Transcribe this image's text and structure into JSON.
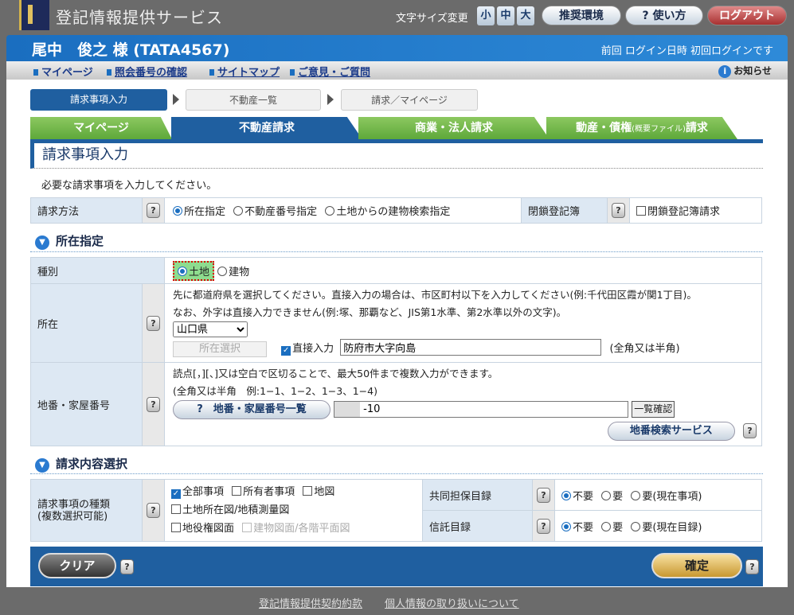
{
  "header": {
    "app_title": "登記情報提供サービス",
    "font_size_label": "文字サイズ変更",
    "font_sizes": [
      "小",
      "中",
      "大"
    ],
    "recommended_env": "推奨環境",
    "help": "使い方",
    "logout": "ログアウト"
  },
  "user": {
    "name": "尾中　俊之 様 (TATA4567)",
    "last_login": "前回 ログイン日時 初回ログインです"
  },
  "nav": {
    "links": [
      "マイページ",
      "照会番号の確認",
      "サイトマップ",
      "ご意見・ご質問"
    ],
    "notice": "お知らせ"
  },
  "steps": [
    "請求事項入力",
    "不動産一覧",
    "請求／マイページ"
  ],
  "tabs": [
    {
      "label": "マイページ"
    },
    {
      "label": "不動産請求"
    },
    {
      "label": "商業・法人請求"
    },
    {
      "label": "動産・債権",
      "sub": "(概要ファイル)",
      "suffix": "請求"
    }
  ],
  "page_title": "請求事項入力",
  "intro": "必要な請求事項を入力してください。",
  "method": {
    "label": "請求方法",
    "options": [
      "所在指定",
      "不動産番号指定",
      "土地からの建物検索指定"
    ],
    "selected": "所在指定",
    "closed_label": "閉鎖登記簿",
    "closed_option": "閉鎖登記簿請求"
  },
  "location_section": {
    "title": "所在指定",
    "kind": {
      "label": "種別",
      "options": [
        "土地",
        "建物"
      ],
      "selected": "土地"
    },
    "location": {
      "label": "所在",
      "note1": "先に都道府県を選択してください。直接入力の場合は、市区町村以下を入力してください(例:千代田区霞が関1丁目)。",
      "note2": "なお、外字は直接入力できません(例:塚、那覇など、JIS第1水準、第2水準以外の文字)。",
      "prefecture": "山口県",
      "select_button": "所在選択",
      "direct_input_label": "直接入力",
      "direct_input_value": "防府市大字向島",
      "width_note": "(全角又は半角)"
    },
    "lot": {
      "label": "地番・家屋番号",
      "note1": "読点[，][、]又は空白で区切ることで、最大50件まで複数入力ができます。",
      "note2": "(全角又は半角　例:1−1、1−2、1−3、1−4)",
      "list_button": "地番・家屋番号一覧",
      "value": "-10",
      "confirm_button": "一覧確認",
      "search_service": "地番検索サービス"
    }
  },
  "content_section": {
    "title": "請求内容選択",
    "type": {
      "label1": "請求事項の種類",
      "label2": "(複数選択可能)",
      "options": [
        {
          "label": "全部事項",
          "checked": true
        },
        {
          "label": "所有者事項",
          "checked": false
        },
        {
          "label": "地図",
          "checked": false
        },
        {
          "label": "土地所在図/地積測量図",
          "checked": false
        },
        {
          "label": "地役権図面",
          "checked": false
        },
        {
          "label": "建物図面/各階平面図",
          "checked": false,
          "disabled": true
        }
      ]
    },
    "joint": {
      "label": "共同担保目録",
      "options": [
        "不要",
        "要",
        "要(現在事項)"
      ],
      "selected": "不要"
    },
    "trust": {
      "label": "信託目録",
      "options": [
        "不要",
        "要",
        "要(現在目録)"
      ],
      "selected": "不要"
    }
  },
  "actions": {
    "clear": "クリア",
    "confirm": "確定"
  },
  "footer": {
    "links": [
      "登記情報提供契約約款",
      "個人情報の取り扱いについて"
    ]
  }
}
